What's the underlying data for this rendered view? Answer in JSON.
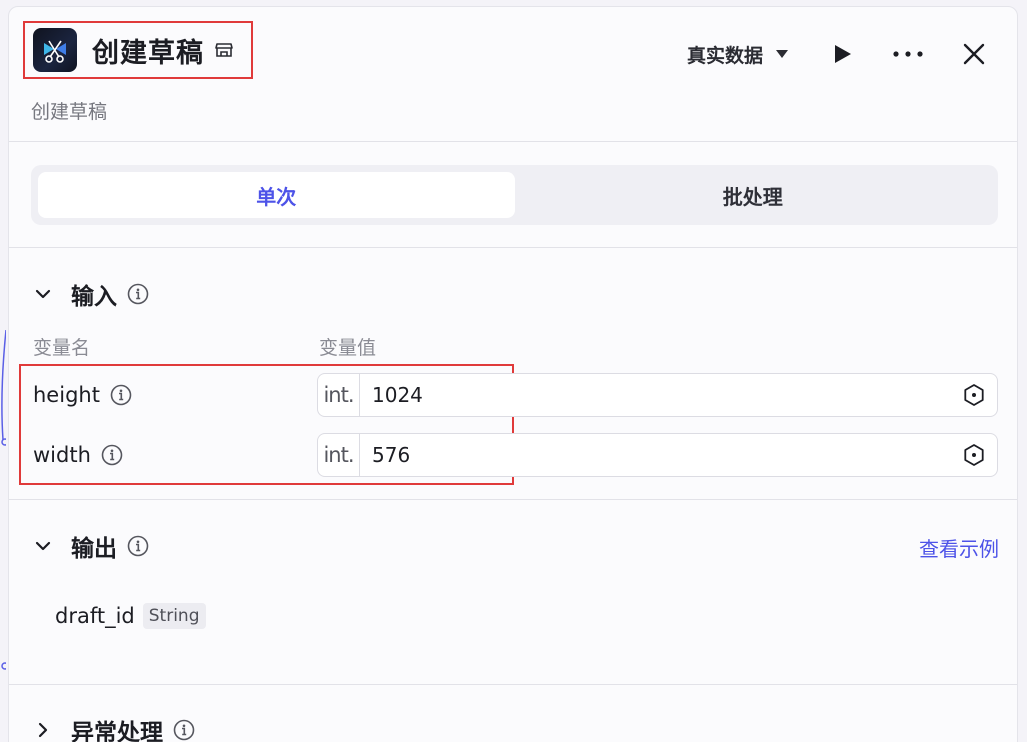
{
  "header": {
    "title": "创建草稿",
    "subtitle": "创建草稿",
    "data_mode": "真实数据"
  },
  "tabs": [
    {
      "label": "单次",
      "active": true
    },
    {
      "label": "批处理",
      "active": false
    }
  ],
  "input": {
    "heading": "输入",
    "col_name": "变量名",
    "col_value": "变量值",
    "vars": [
      {
        "name": "height",
        "type": "int.",
        "value": "1024"
      },
      {
        "name": "width",
        "type": "int.",
        "value": "576"
      }
    ]
  },
  "output": {
    "heading": "输出",
    "example_link": "查看示例",
    "fields": [
      {
        "name": "draft_id",
        "type": "String"
      }
    ]
  },
  "exception": {
    "heading": "异常处理"
  },
  "colors": {
    "accent": "#4d53e8",
    "highlight_border": "#e03a3a"
  }
}
